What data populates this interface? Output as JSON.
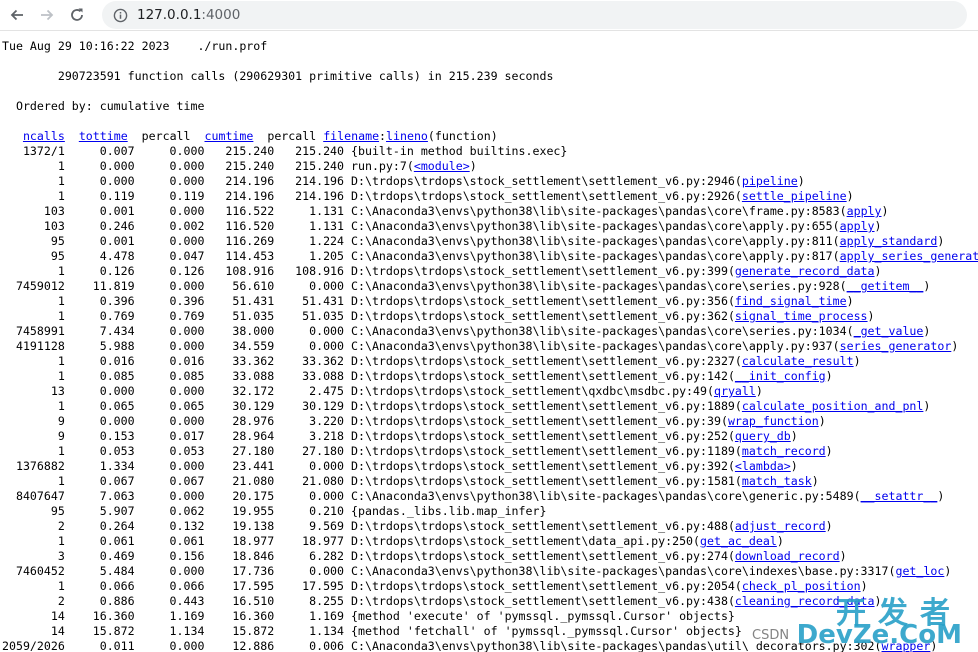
{
  "browser": {
    "url_host": "127.0.0.1",
    "url_port": ":4000",
    "icons": [
      "back-arrow-icon",
      "forward-arrow-icon",
      "reload-icon",
      "info-icon"
    ]
  },
  "profile": {
    "timestamp_line": "Tue Aug 29 10:16:22 2023    ./run.prof",
    "summary_line": "        290723591 function calls (290629301 primitive calls) in 215.239 seconds",
    "ordered_line": "  Ordered by: cumulative time",
    "headers": {
      "ncalls": "ncalls",
      "tottime": "tottime",
      "percall1": "percall",
      "cumtime": "cumtime",
      "percall2": "percall",
      "filename": "filename",
      "lineno": "lineno",
      "function": "(function)"
    },
    "rows": [
      {
        "ncalls": "1372/1",
        "tottime": "0.007",
        "percall1": "0.000",
        "cumtime": "215.240",
        "percall2": "215.240",
        "location": "{built-in method builtins.exec}",
        "func": ""
      },
      {
        "ncalls": "1",
        "tottime": "0.000",
        "percall1": "0.000",
        "cumtime": "215.240",
        "percall2": "215.240",
        "location": "run.py:7",
        "func": "<module>"
      },
      {
        "ncalls": "1",
        "tottime": "0.000",
        "percall1": "0.000",
        "cumtime": "214.196",
        "percall2": "214.196",
        "location": "D:\\trdops\\trdops\\stock_settlement\\settlement_v6.py:2946",
        "func": "pipeline"
      },
      {
        "ncalls": "1",
        "tottime": "0.119",
        "percall1": "0.119",
        "cumtime": "214.196",
        "percall2": "214.196",
        "location": "D:\\trdops\\trdops\\stock_settlement\\settlement_v6.py:2926",
        "func": "settle_pipeline"
      },
      {
        "ncalls": "103",
        "tottime": "0.001",
        "percall1": "0.000",
        "cumtime": "116.522",
        "percall2": "1.131",
        "location": "C:\\Anaconda3\\envs\\python38\\lib\\site-packages\\pandas\\core\\frame.py:8583",
        "func": "apply"
      },
      {
        "ncalls": "103",
        "tottime": "0.246",
        "percall1": "0.002",
        "cumtime": "116.520",
        "percall2": "1.131",
        "location": "C:\\Anaconda3\\envs\\python38\\lib\\site-packages\\pandas\\core\\apply.py:655",
        "func": "apply"
      },
      {
        "ncalls": "95",
        "tottime": "0.001",
        "percall1": "0.000",
        "cumtime": "116.269",
        "percall2": "1.224",
        "location": "C:\\Anaconda3\\envs\\python38\\lib\\site-packages\\pandas\\core\\apply.py:811",
        "func": "apply_standard"
      },
      {
        "ncalls": "95",
        "tottime": "4.478",
        "percall1": "0.047",
        "cumtime": "114.453",
        "percall2": "1.205",
        "location": "C:\\Anaconda3\\envs\\python38\\lib\\site-packages\\pandas\\core\\apply.py:817",
        "func": "apply_series_generator"
      },
      {
        "ncalls": "1",
        "tottime": "0.126",
        "percall1": "0.126",
        "cumtime": "108.916",
        "percall2": "108.916",
        "location": "D:\\trdops\\trdops\\stock_settlement\\settlement_v6.py:399",
        "func": "generate_record_data"
      },
      {
        "ncalls": "7459012",
        "tottime": "11.819",
        "percall1": "0.000",
        "cumtime": "56.610",
        "percall2": "0.000",
        "location": "C:\\Anaconda3\\envs\\python38\\lib\\site-packages\\pandas\\core\\series.py:928",
        "func": "__getitem__"
      },
      {
        "ncalls": "1",
        "tottime": "0.396",
        "percall1": "0.396",
        "cumtime": "51.431",
        "percall2": "51.431",
        "location": "D:\\trdops\\trdops\\stock_settlement\\settlement_v6.py:356",
        "func": "find_signal_time"
      },
      {
        "ncalls": "1",
        "tottime": "0.769",
        "percall1": "0.769",
        "cumtime": "51.035",
        "percall2": "51.035",
        "location": "D:\\trdops\\trdops\\stock_settlement\\settlement_v6.py:362",
        "func": "signal_time_process"
      },
      {
        "ncalls": "7458991",
        "tottime": "7.434",
        "percall1": "0.000",
        "cumtime": "38.000",
        "percall2": "0.000",
        "location": "C:\\Anaconda3\\envs\\python38\\lib\\site-packages\\pandas\\core\\series.py:1034",
        "func": "_get_value"
      },
      {
        "ncalls": "4191128",
        "tottime": "5.988",
        "percall1": "0.000",
        "cumtime": "34.559",
        "percall2": "0.000",
        "location": "C:\\Anaconda3\\envs\\python38\\lib\\site-packages\\pandas\\core\\apply.py:937",
        "func": "series_generator"
      },
      {
        "ncalls": "1",
        "tottime": "0.016",
        "percall1": "0.016",
        "cumtime": "33.362",
        "percall2": "33.362",
        "location": "D:\\trdops\\trdops\\stock_settlement\\settlement_v6.py:2327",
        "func": "calculate_result"
      },
      {
        "ncalls": "1",
        "tottime": "0.085",
        "percall1": "0.085",
        "cumtime": "33.088",
        "percall2": "33.088",
        "location": "D:\\trdops\\trdops\\stock_settlement\\settlement_v6.py:142",
        "func": "__init_config"
      },
      {
        "ncalls": "13",
        "tottime": "0.000",
        "percall1": "0.000",
        "cumtime": "32.172",
        "percall2": "2.475",
        "location": "D:\\trdops\\trdops\\stock_settlement\\qxdbc\\msdbc.py:49",
        "func": "qryall"
      },
      {
        "ncalls": "1",
        "tottime": "0.065",
        "percall1": "0.065",
        "cumtime": "30.129",
        "percall2": "30.129",
        "location": "D:\\trdops\\trdops\\stock_settlement\\settlement_v6.py:1889",
        "func": "calculate_position_and_pnl"
      },
      {
        "ncalls": "9",
        "tottime": "0.000",
        "percall1": "0.000",
        "cumtime": "28.976",
        "percall2": "3.220",
        "location": "D:\\trdops\\trdops\\stock_settlement\\settlement_v6.py:39",
        "func": "wrap_function"
      },
      {
        "ncalls": "9",
        "tottime": "0.153",
        "percall1": "0.017",
        "cumtime": "28.964",
        "percall2": "3.218",
        "location": "D:\\trdops\\trdops\\stock_settlement\\settlement_v6.py:252",
        "func": "query_db"
      },
      {
        "ncalls": "1",
        "tottime": "0.053",
        "percall1": "0.053",
        "cumtime": "27.180",
        "percall2": "27.180",
        "location": "D:\\trdops\\trdops\\stock_settlement\\settlement_v6.py:1189",
        "func": "match_record"
      },
      {
        "ncalls": "1376882",
        "tottime": "1.334",
        "percall1": "0.000",
        "cumtime": "23.441",
        "percall2": "0.000",
        "location": "D:\\trdops\\trdops\\stock_settlement\\settlement_v6.py:392",
        "func": "<lambda>"
      },
      {
        "ncalls": "1",
        "tottime": "0.067",
        "percall1": "0.067",
        "cumtime": "21.080",
        "percall2": "21.080",
        "location": "D:\\trdops\\trdops\\stock_settlement\\settlement_v6.py:1581",
        "func": "match_task"
      },
      {
        "ncalls": "8407647",
        "tottime": "7.063",
        "percall1": "0.000",
        "cumtime": "20.175",
        "percall2": "0.000",
        "location": "C:\\Anaconda3\\envs\\python38\\lib\\site-packages\\pandas\\core\\generic.py:5489",
        "func": "__setattr__"
      },
      {
        "ncalls": "95",
        "tottime": "5.907",
        "percall1": "0.062",
        "cumtime": "19.955",
        "percall2": "0.210",
        "location": "{pandas._libs.lib.map_infer}",
        "func": ""
      },
      {
        "ncalls": "2",
        "tottime": "0.264",
        "percall1": "0.132",
        "cumtime": "19.138",
        "percall2": "9.569",
        "location": "D:\\trdops\\trdops\\stock_settlement\\settlement_v6.py:488",
        "func": "adjust_record"
      },
      {
        "ncalls": "1",
        "tottime": "0.061",
        "percall1": "0.061",
        "cumtime": "18.977",
        "percall2": "18.977",
        "location": "D:\\trdops\\trdops\\stock_settlement\\data_api.py:250",
        "func": "get_ac_deal"
      },
      {
        "ncalls": "3",
        "tottime": "0.469",
        "percall1": "0.156",
        "cumtime": "18.846",
        "percall2": "6.282",
        "location": "D:\\trdops\\trdops\\stock_settlement\\settlement_v6.py:274",
        "func": "download_record"
      },
      {
        "ncalls": "7460452",
        "tottime": "5.484",
        "percall1": "0.000",
        "cumtime": "17.736",
        "percall2": "0.000",
        "location": "C:\\Anaconda3\\envs\\python38\\lib\\site-packages\\pandas\\core\\indexes\\base.py:3317",
        "func": "get_loc"
      },
      {
        "ncalls": "1",
        "tottime": "0.066",
        "percall1": "0.066",
        "cumtime": "17.595",
        "percall2": "17.595",
        "location": "D:\\trdops\\trdops\\stock_settlement\\settlement_v6.py:2054",
        "func": "check_pl_position"
      },
      {
        "ncalls": "2",
        "tottime": "0.886",
        "percall1": "0.443",
        "cumtime": "16.510",
        "percall2": "8.255",
        "location": "D:\\trdops\\trdops\\stock_settlement\\settlement_v6.py:438",
        "func": "cleaning_record_data"
      },
      {
        "ncalls": "14",
        "tottime": "16.360",
        "percall1": "1.169",
        "cumtime": "16.360",
        "percall2": "1.169",
        "location": "{method 'execute' of 'pymssql._pymssql.Cursor' objects}",
        "func": ""
      },
      {
        "ncalls": "14",
        "tottime": "15.872",
        "percall1": "1.134",
        "cumtime": "15.872",
        "percall2": "1.134",
        "location": "{method 'fetchall' of 'pymssql._pymssql.Cursor' objects}",
        "func": ""
      },
      {
        "ncalls": "2059/2026",
        "tottime": "0.011",
        "percall1": "0.000",
        "cumtime": "12.886",
        "percall2": "0.006",
        "location": "C:\\Anaconda3\\envs\\python38\\lib\\site-packages\\pandas\\util\\_decorators.py:302",
        "func": "wrapper"
      }
    ]
  },
  "watermark": {
    "cn": "开发者",
    "en": "DevZe.CoM",
    "csdn": "CSDN"
  }
}
